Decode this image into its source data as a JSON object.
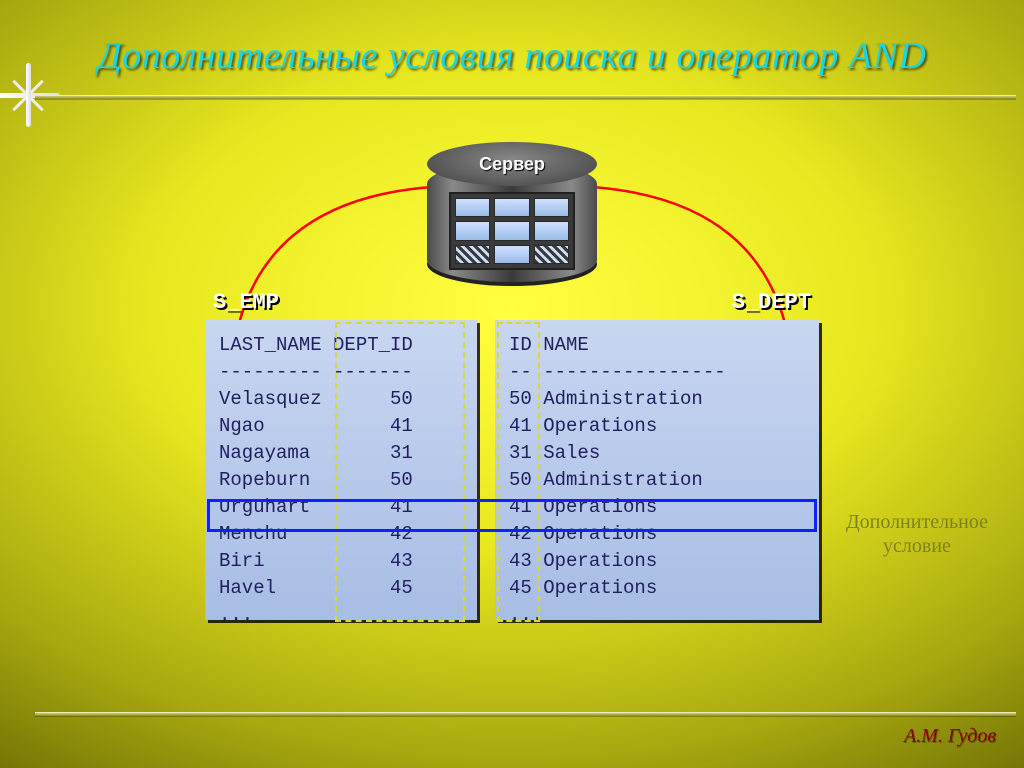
{
  "title": "Дополнительные условия поиска и оператор AND",
  "server_label": "Сервер",
  "side_note_line1": "Дополнительное",
  "side_note_line2": "условие",
  "author": "А.М. Гудов",
  "tables": {
    "s_emp": {
      "label": "S_EMP",
      "headers": [
        "LAST_NAME",
        "DEPT_ID"
      ],
      "divider": "--------- -------",
      "rows": [
        [
          "Velasquez",
          "50"
        ],
        [
          "Ngao",
          "41"
        ],
        [
          "Nagayama",
          "31"
        ],
        [
          "Ropeburn",
          "50"
        ],
        [
          "Urguhart",
          "41"
        ],
        [
          "Menchu",
          "42"
        ],
        [
          "Biri",
          "43"
        ],
        [
          "Havel",
          "45"
        ],
        [
          "...",
          ""
        ]
      ]
    },
    "s_dept": {
      "label": "S_DEPT",
      "headers": [
        "ID",
        "NAME"
      ],
      "divider": "-- ----------------",
      "rows": [
        [
          "50",
          "Administration"
        ],
        [
          "41",
          "Operations"
        ],
        [
          "31",
          "Sales"
        ],
        [
          "50",
          "Administration"
        ],
        [
          "41",
          "Operations"
        ],
        [
          "42",
          "Operations"
        ],
        [
          "43",
          "Operations"
        ],
        [
          "45",
          "Operations"
        ],
        [
          "...",
          ""
        ]
      ]
    }
  },
  "highlight_row_index": 5,
  "join_columns": [
    "DEPT_ID",
    "ID"
  ]
}
